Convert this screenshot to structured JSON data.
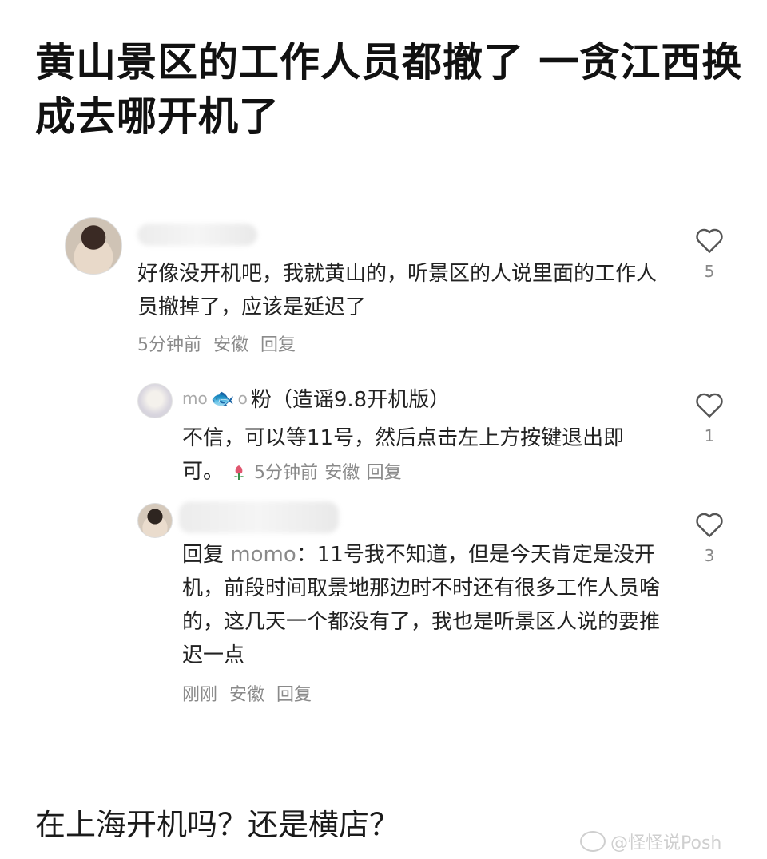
{
  "post": {
    "headline": "黄山景区的工作人员都撤了 一贪江西换成去哪开机了"
  },
  "comments": [
    {
      "text": "好像没开机吧，我就黄山的，听景区的人说里面的工作人员撤掉了，应该是延迟了",
      "time": "5分钟前",
      "location": "安徽",
      "reply_label": "回复",
      "likes": "5"
    },
    {
      "user_prefix": "mo",
      "user_suffix": "o",
      "user_name": "粉（造谣9.8开机版）",
      "text": "不信，可以等11号，然后点击左上方按键退出即可。",
      "time": "5分钟前",
      "location": "安徽",
      "reply_label": "回复",
      "likes": "1"
    },
    {
      "reply_prefix": "回复",
      "reply_target": "momo",
      "text": "：11号我不知道，但是今天肯定是没开机，前段时间取景地那边时不时还有很多工作人员啥的，这几天一个都没有了，我也是听景区人说的要推迟一点",
      "time": "刚刚",
      "location": "安徽",
      "reply_label": "回复",
      "likes": "3"
    }
  ],
  "footer": {
    "question": "在上海开机吗？还是横店？",
    "watermark": "@怪怪说Posh"
  },
  "colors": {
    "text": "#222222",
    "meta": "#8a8a8a",
    "like_outline": "#555555"
  },
  "icons": [
    "heart-outline-icon",
    "fish-emoji-icon",
    "tulip-emoji-icon",
    "weibo-logo-icon"
  ]
}
